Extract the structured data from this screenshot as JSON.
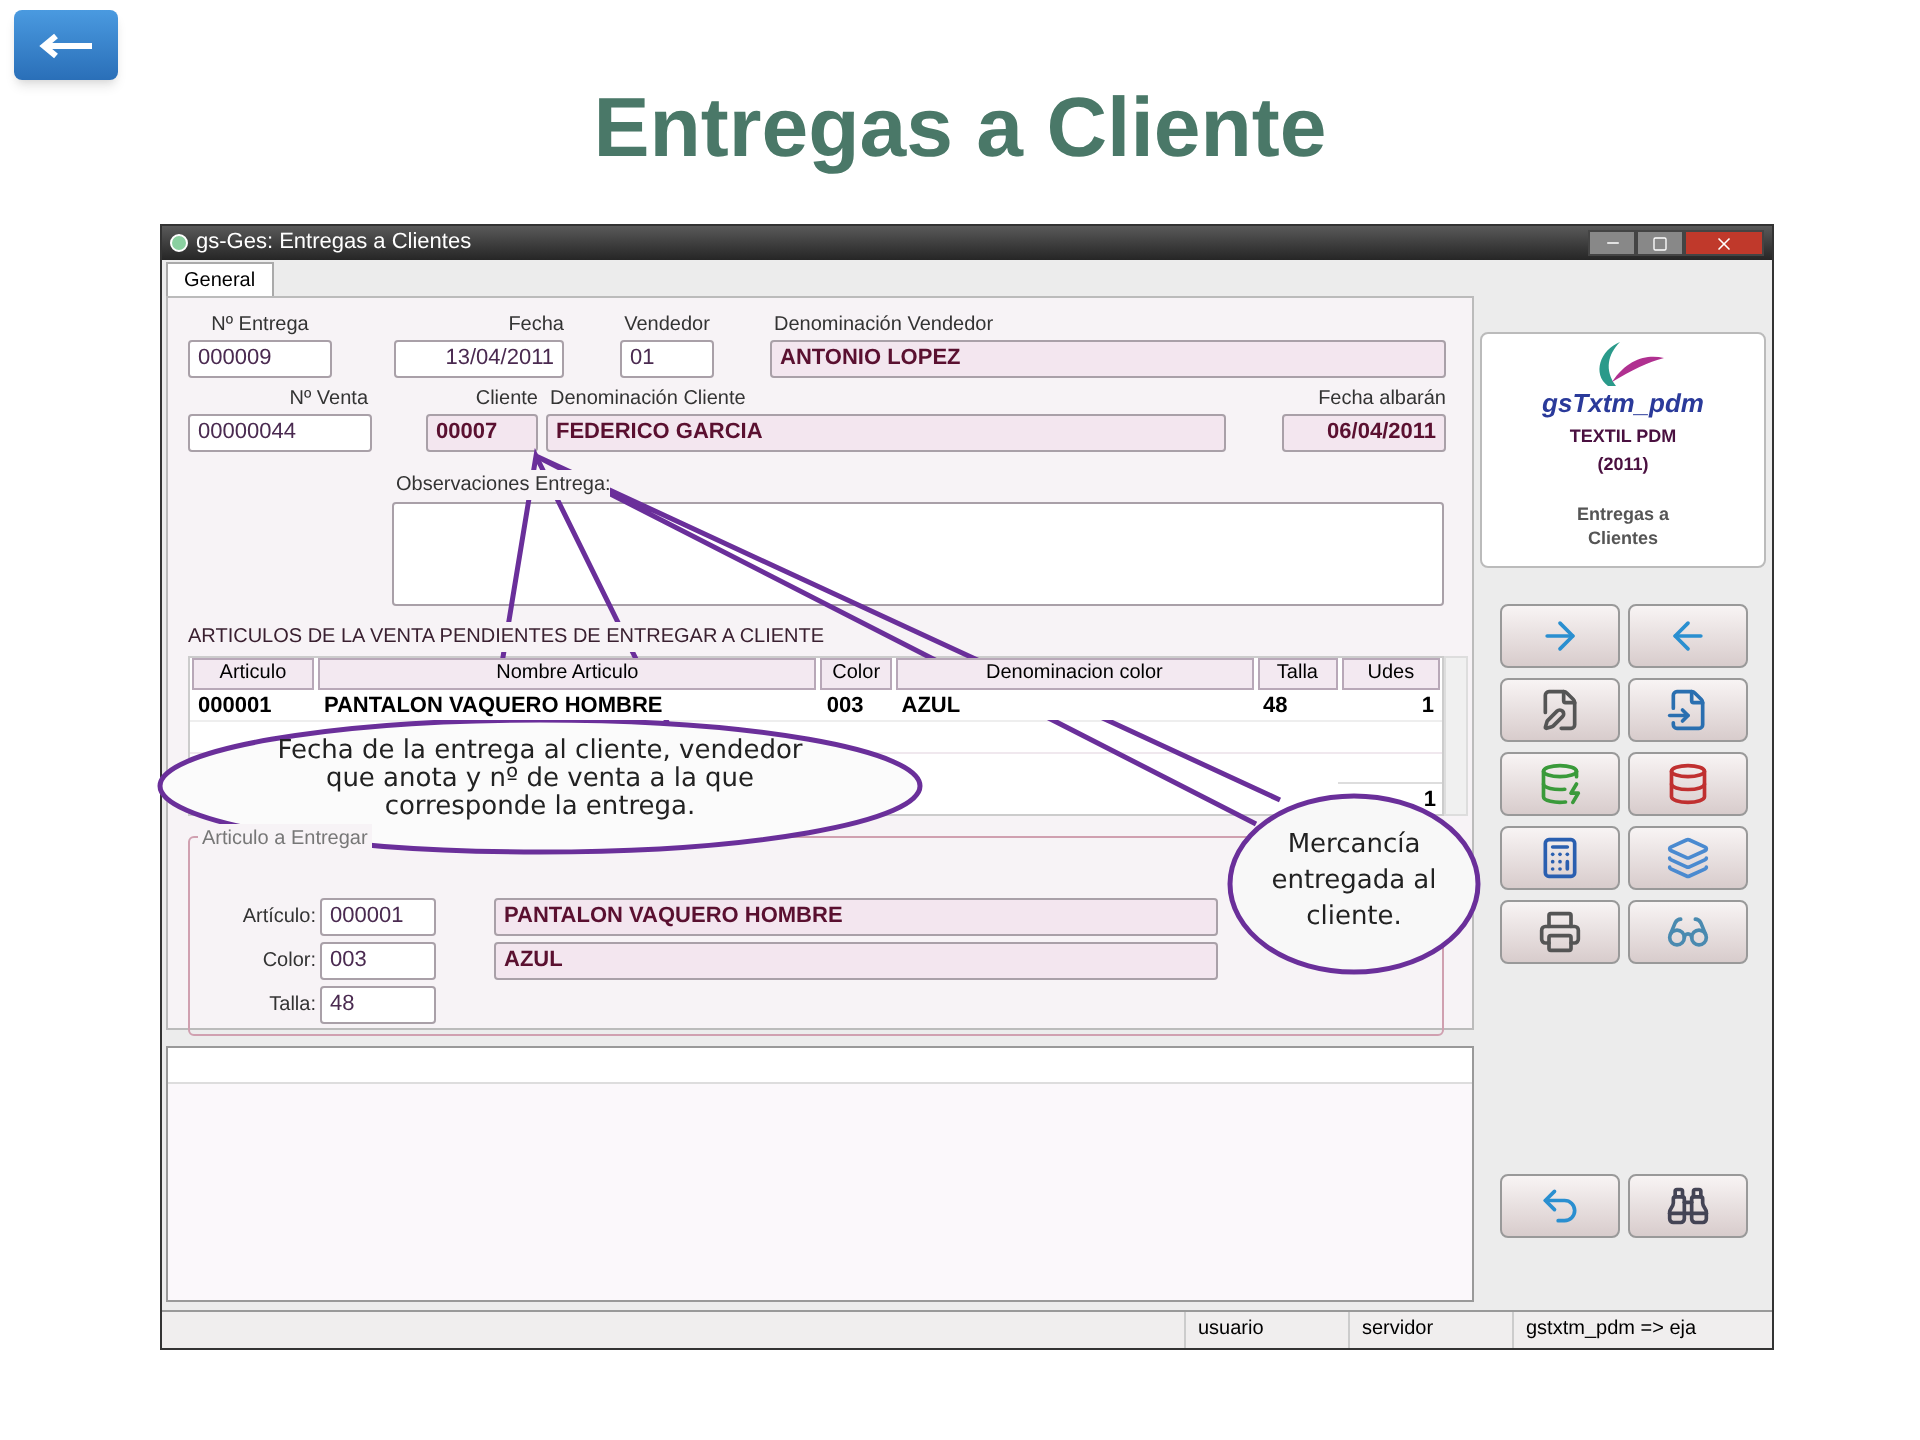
{
  "slide_title": "Entregas a Cliente",
  "window": {
    "title": "gs-Ges: Entregas a Clientes"
  },
  "tabs": [
    {
      "label": "General",
      "selected": true
    }
  ],
  "header_fields": [
    {
      "label": "Nº Entrega",
      "value": "000009",
      "readonly": false
    },
    {
      "label": "Fecha",
      "value": "13/04/2011",
      "readonly": false
    },
    {
      "label": "Vendedor",
      "value": "01",
      "readonly": false
    },
    {
      "label": "Denominación Vendedor",
      "value": "ANTONIO LOPEZ",
      "readonly": true
    },
    {
      "label": "Nº Venta",
      "value": "00000044",
      "readonly": false
    },
    {
      "label": "Cliente",
      "value": "00007",
      "readonly": true
    },
    {
      "label": "Denominación Cliente",
      "value": "FEDERICO GARCIA",
      "readonly": true
    },
    {
      "label": "Fecha albarán",
      "value": "06/04/2011",
      "readonly": true
    }
  ],
  "observaciones": {
    "label": "Observaciones Entrega:"
  },
  "table": {
    "title": "ARTICULOS DE LA VENTA PENDIENTES DE ENTREGAR A CLIENTE",
    "columns": [
      "Articulo",
      "Nombre Articulo",
      "Color",
      "Denominacion color",
      "Talla",
      "Udes"
    ],
    "rows": [
      [
        "000001",
        "PANTALON VAQUERO HOMBRE",
        "003",
        "AZUL",
        "48",
        "1"
      ]
    ],
    "total": "1"
  },
  "articulo_entregar": {
    "legend": "Articulo a Entregar",
    "fields": [
      {
        "label": "Artículo:",
        "value": "000001",
        "description": "PANTALON VAQUERO HOMBRE"
      },
      {
        "label": "Color:",
        "value": "003",
        "description": "AZUL"
      },
      {
        "label": "Talla:",
        "value": "48"
      }
    ]
  },
  "side_panel": {
    "app_name": "gsTxtm_pdm",
    "company": "TEXTIL PDM",
    "year": "(2011)",
    "module": "Entregas a Clientes"
  },
  "status_bar": [
    "usuario",
    "servidor",
    "gstxtm_pdm => eja"
  ],
  "callouts": [
    {
      "text": "Fecha de la entrega al cliente, vendedor que anota y nº de venta a la que corresponde la entrega."
    },
    {
      "text": "Mercancía entregada al cliente."
    }
  ]
}
